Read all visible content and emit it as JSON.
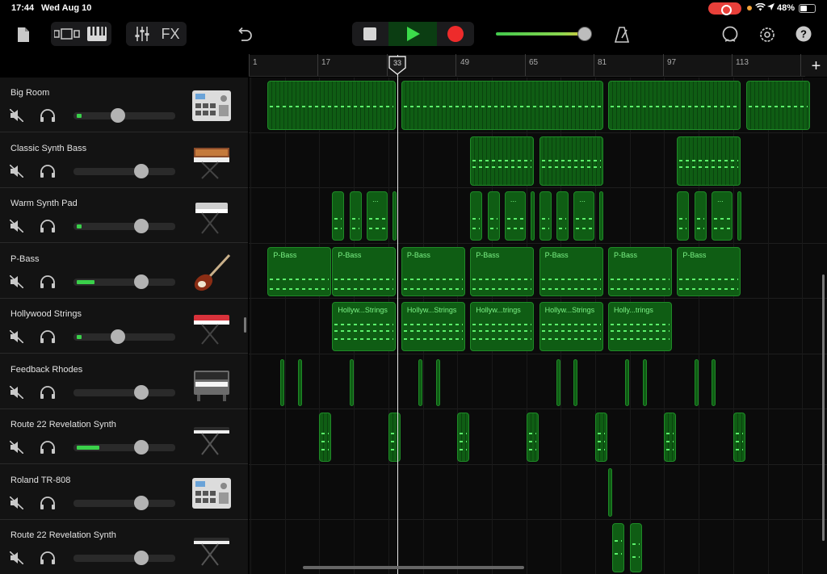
{
  "status_bar": {
    "time": "17:44",
    "date": "Wed Aug 10",
    "battery": "48%",
    "battery_level": 0.48
  },
  "toolbar": {
    "icons": [
      "document-icon",
      "track-view-icon",
      "keyboard-icon",
      "mixer-icon",
      "undo-icon",
      "metronome-icon",
      "loop-icon",
      "settings-icon",
      "help-icon"
    ],
    "fx_label": "FX",
    "master_volume": 0.95,
    "colors": {
      "play": "#3bdc4a",
      "record": "#ee2b2b",
      "region": "#0f5d14"
    }
  },
  "ruler": {
    "markers": [
      "1",
      "17",
      "33",
      "49",
      "65",
      "81",
      "97",
      "113"
    ],
    "playhead_bar": 33
  },
  "tracks": [
    {
      "name": "Big Room",
      "instrument": "drum-machine",
      "volume": 0.43,
      "meter": 0.05
    },
    {
      "name": "Classic Synth Bass",
      "instrument": "synthesizer",
      "volume": 0.69,
      "meter": 0
    },
    {
      "name": "Warm Synth Pad",
      "instrument": "keyboard-stand",
      "volume": 0.69,
      "meter": 0.05
    },
    {
      "name": "P-Bass",
      "instrument": "bass-guitar",
      "volume": 0.69,
      "meter": 0.18
    },
    {
      "name": "Hollywood Strings",
      "instrument": "red-keyboard",
      "volume": 0.43,
      "meter": 0.05
    },
    {
      "name": "Feedback Rhodes",
      "instrument": "electric-piano",
      "volume": 0.69,
      "meter": 0
    },
    {
      "name": "Route 22 Revelation Synth",
      "instrument": "synthesizer-stand",
      "volume": 0.69,
      "meter": 0.23
    },
    {
      "name": "Roland TR-808",
      "instrument": "drum-machine",
      "volume": 0.69,
      "meter": 0
    },
    {
      "name": "Route 22 Revelation Synth",
      "instrument": "synthesizer-stand",
      "volume": 0.69,
      "meter": 0
    }
  ],
  "regions": {
    "p_bass_label": "P-Bass",
    "strings_labels": [
      "Hollyw...Strings",
      "Hollyw...Strings",
      "Hollyw...trings",
      "Hollyw...Strings",
      "Holly...trings"
    ],
    "pad_label": "..."
  }
}
